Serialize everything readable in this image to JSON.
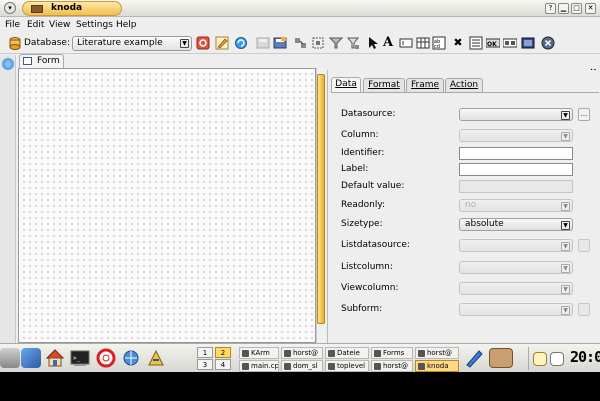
{
  "window": {
    "title": "knoda"
  },
  "menubar": {
    "items": [
      "File",
      "Edit",
      "View",
      "Settings",
      "Help"
    ]
  },
  "toolbar": {
    "database_label": "Database:",
    "database_value": "Literature example"
  },
  "form_tab": {
    "label": "Form"
  },
  "property_tabs": [
    "Data",
    "Format",
    "Frame",
    "Action"
  ],
  "properties": [
    {
      "label": "Datasource:",
      "kind": "combo",
      "value": "",
      "enabled": true,
      "button": "..."
    },
    {
      "label": "Column:",
      "kind": "combo",
      "value": "",
      "enabled": false
    },
    {
      "label": "Identifier:",
      "kind": "text",
      "value": "",
      "enabled": true
    },
    {
      "label": "Label:",
      "kind": "text",
      "value": "",
      "enabled": true
    },
    {
      "label": "Default value:",
      "kind": "text",
      "value": "",
      "enabled": false
    },
    {
      "label": "Readonly:",
      "kind": "combo",
      "value": "no",
      "enabled": false
    },
    {
      "label": "Sizetype:",
      "kind": "combo",
      "value": "absolute",
      "enabled": true
    },
    {
      "label": "Listdatasource:",
      "kind": "combo",
      "value": "",
      "enabled": false,
      "button": ""
    },
    {
      "label": "Listcolumn:",
      "kind": "combo",
      "value": "",
      "enabled": false
    },
    {
      "label": "Viewcolumn:",
      "kind": "combo",
      "value": "",
      "enabled": false
    },
    {
      "label": "Subform:",
      "kind": "combo",
      "value": "",
      "enabled": false,
      "button": ""
    }
  ],
  "taskbar": {
    "pager": [
      "1",
      "2",
      "3",
      "4"
    ],
    "active_desktop": "2",
    "tasks_top": [
      "KArm",
      "horst@",
      "Dateie",
      "Forms",
      "horst@"
    ],
    "tasks_bottom": [
      "main.cp",
      "dom_sl",
      "toplevel",
      "horst@",
      "knoda"
    ],
    "active_task": "knoda",
    "clock": "20:0"
  },
  "colors": {
    "accent": "#f2be50",
    "active_task": "#ffd788"
  }
}
